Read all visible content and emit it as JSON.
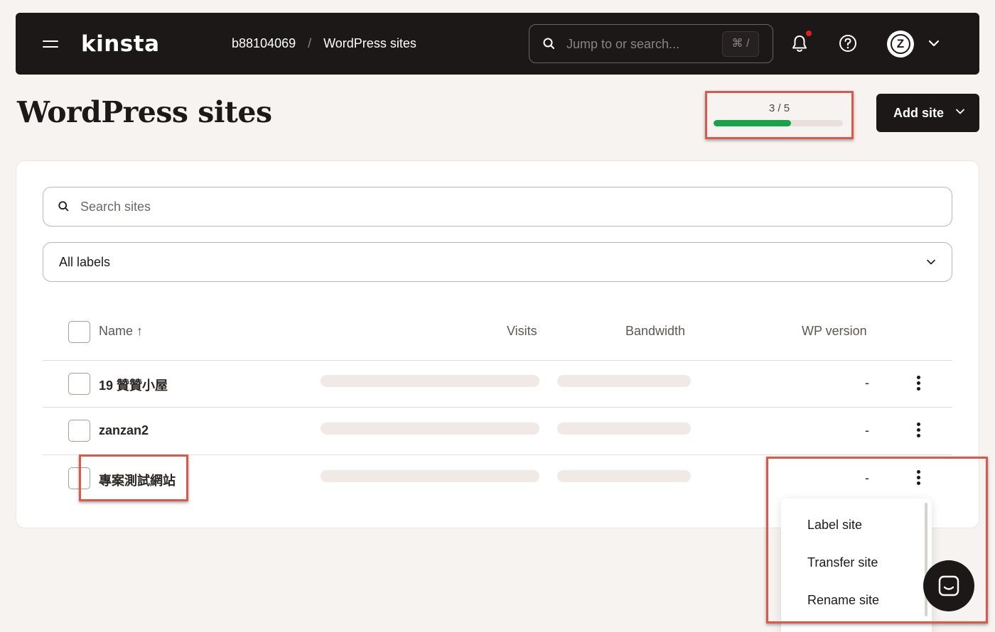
{
  "topbar": {
    "logo": "kinsta",
    "breadcrumb": {
      "account": "b88104069",
      "separator": "/",
      "current": "WordPress sites"
    },
    "search": {
      "placeholder": "Jump to or search...",
      "shortcut": "⌘ /"
    },
    "avatar_initial": "Z"
  },
  "page": {
    "title": "WordPress sites",
    "usage": {
      "label": "3 / 5",
      "used": 3,
      "total": 5,
      "fill_fraction": 0.6,
      "color": "#16a34a"
    },
    "add_site_label": "Add site"
  },
  "filters": {
    "search_placeholder": "Search sites",
    "labels_selected": "All labels"
  },
  "table": {
    "headers": {
      "name": "Name ↑",
      "visits": "Visits",
      "bandwidth": "Bandwidth",
      "wp_version": "WP version"
    },
    "rows": [
      {
        "name": "19 贊贊小屋",
        "wp_version": "-"
      },
      {
        "name": "zanzan2",
        "wp_version": "-"
      },
      {
        "name": "專案測試網站",
        "wp_version": "-"
      }
    ]
  },
  "row_menu": {
    "items": [
      "Label site",
      "Transfer site",
      "Rename site"
    ]
  },
  "colors": {
    "accent": "#d9594c",
    "dark": "#1c1818",
    "background": "#f6f3f1"
  }
}
